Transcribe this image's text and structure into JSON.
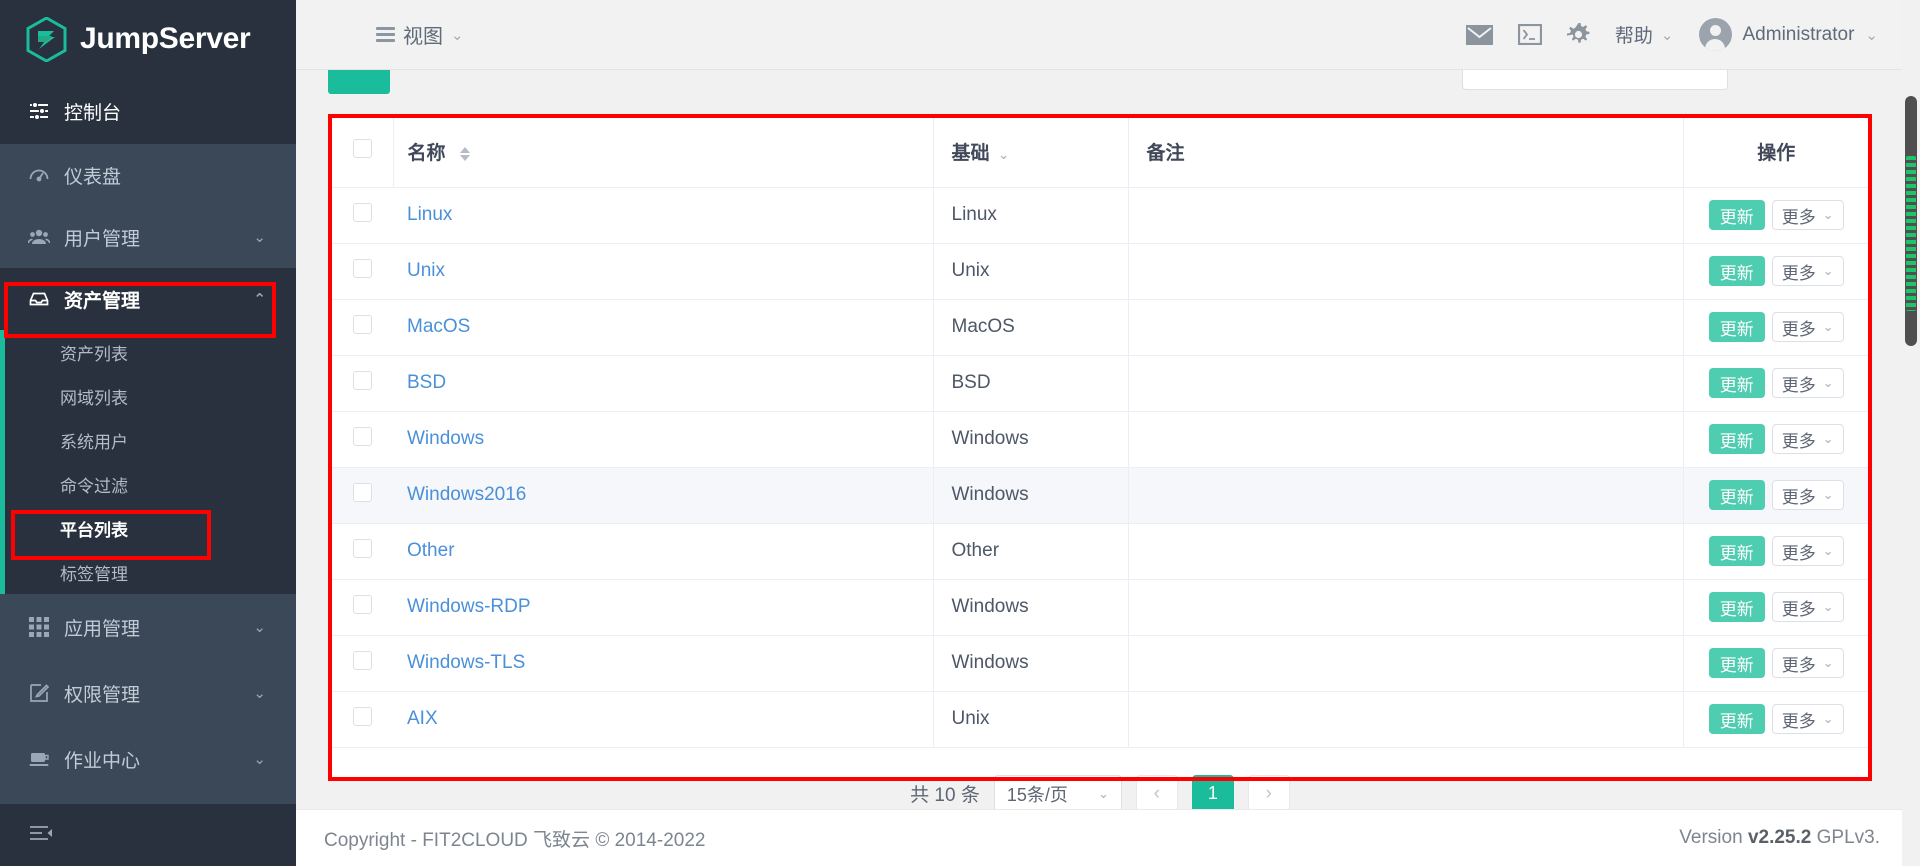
{
  "brand": {
    "name": "JumpServer",
    "logo_icon": "jumpserver-logo-icon"
  },
  "sidebar": {
    "console_label": "控制台",
    "console_icon": "sliders-icon",
    "collapse_icon": "collapse-sidebar-icon",
    "items": [
      {
        "label": "仪表盘",
        "icon": "dashboard-icon",
        "chevron": "",
        "name": "dashboard"
      },
      {
        "label": "用户管理",
        "icon": "users-icon",
        "chevron": "⌄",
        "name": "user-management"
      },
      {
        "label": "资产管理",
        "icon": "inbox-icon",
        "chevron": "⌃",
        "name": "asset-management"
      },
      {
        "label": "应用管理",
        "icon": "apps-grid-icon",
        "chevron": "⌄",
        "name": "app-management"
      },
      {
        "label": "权限管理",
        "icon": "edit-square-icon",
        "chevron": "⌄",
        "name": "permission-management"
      },
      {
        "label": "作业中心",
        "icon": "terminal-screen-icon",
        "chevron": "⌄",
        "name": "job-center"
      }
    ],
    "submenu": [
      {
        "label": "资产列表",
        "name": "asset-list"
      },
      {
        "label": "网域列表",
        "name": "domain-list"
      },
      {
        "label": "系统用户",
        "name": "system-user"
      },
      {
        "label": "命令过滤",
        "name": "command-filter"
      },
      {
        "label": "平台列表",
        "name": "platform-list"
      },
      {
        "label": "标签管理",
        "name": "label-management"
      }
    ]
  },
  "topbar": {
    "view_label": "视图",
    "view_chevron": "⌄",
    "mail_icon": "mail-icon",
    "terminal_icon": "terminal-icon",
    "settings_icon": "gear-icon",
    "help_label": "帮助",
    "help_chevron": "⌄",
    "user_name": "Administrator",
    "user_chevron": "⌄"
  },
  "table": {
    "headers": {
      "name": "名称",
      "base": "基础",
      "base_chevron": "⌄",
      "note": "备注",
      "operation": "操作"
    },
    "rows": [
      {
        "name": "Linux",
        "base": "Linux",
        "note": "",
        "hover": false
      },
      {
        "name": "Unix",
        "base": "Unix",
        "note": "",
        "hover": false
      },
      {
        "name": "MacOS",
        "base": "MacOS",
        "note": "",
        "hover": false
      },
      {
        "name": "BSD",
        "base": "BSD",
        "note": "",
        "hover": false
      },
      {
        "name": "Windows",
        "base": "Windows",
        "note": "",
        "hover": false
      },
      {
        "name": "Windows2016",
        "base": "Windows",
        "note": "",
        "hover": true
      },
      {
        "name": "Other",
        "base": "Other",
        "note": "",
        "hover": false
      },
      {
        "name": "Windows-RDP",
        "base": "Windows",
        "note": "",
        "hover": false
      },
      {
        "name": "Windows-TLS",
        "base": "Windows",
        "note": "",
        "hover": false
      },
      {
        "name": "AIX",
        "base": "Unix",
        "note": "",
        "hover": false
      }
    ],
    "actions": {
      "update_label": "更新",
      "more_label": "更多",
      "more_chevron": "⌄"
    }
  },
  "pagination": {
    "total_label": "共 10 条",
    "page_size_label": "15条/页",
    "page_size_chevron": "⌄",
    "prev_label": "‹",
    "next_label": "›",
    "current_page": "1"
  },
  "footer": {
    "copyright": "Copyright - FIT2CLOUD 飞致云 © 2014-2022",
    "version_prefix": "Version",
    "version_number": "v2.25.2",
    "version_suffix": "GPLv3."
  },
  "colors": {
    "brand_green": "#1abc9c",
    "sidebar_bg": "#3a4857",
    "sidebar_dark": "#28313d",
    "link_blue": "#4a90d9",
    "highlight_red": "#ff0000"
  }
}
